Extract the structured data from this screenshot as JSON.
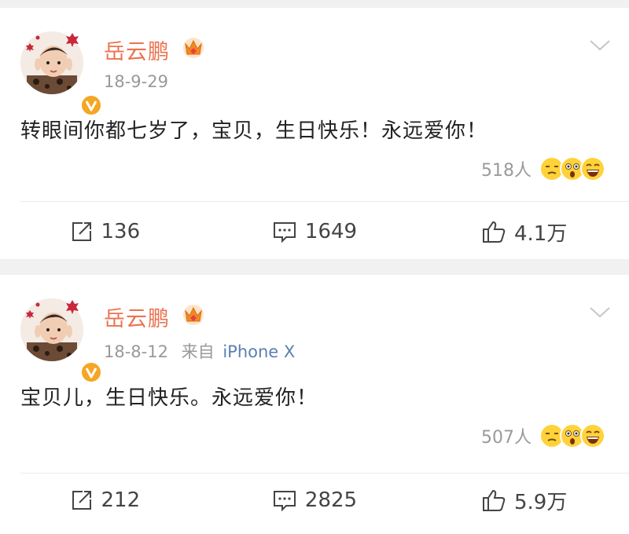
{
  "colors": {
    "name": "#eb7350",
    "meta": "#999999",
    "device": "#5b7fb0",
    "text": "#222222",
    "badge": "#f5a623",
    "background": "#f1f1f1"
  },
  "posts": [
    {
      "author": "岳云鹏",
      "time": "18-9-29",
      "source_label": "",
      "source_device": "",
      "content": "转眼间你都七岁了，宝贝，生日快乐！永远爱你！",
      "reaction_count": "518人",
      "reaction_icons": [
        "annoyed-face-icon",
        "shocked-face-icon",
        "laughing-face-icon"
      ],
      "actions": {
        "repost": "136",
        "comment": "1649",
        "like": "4.1万"
      }
    },
    {
      "author": "岳云鹏",
      "time": "18-8-12",
      "source_label": "来自",
      "source_device": "iPhone X",
      "content": "宝贝儿，生日快乐。永远爱你！",
      "reaction_count": "507人",
      "reaction_icons": [
        "annoyed-face-icon",
        "shocked-face-icon",
        "laughing-face-icon"
      ],
      "actions": {
        "repost": "212",
        "comment": "2825",
        "like": "5.9万"
      }
    }
  ]
}
